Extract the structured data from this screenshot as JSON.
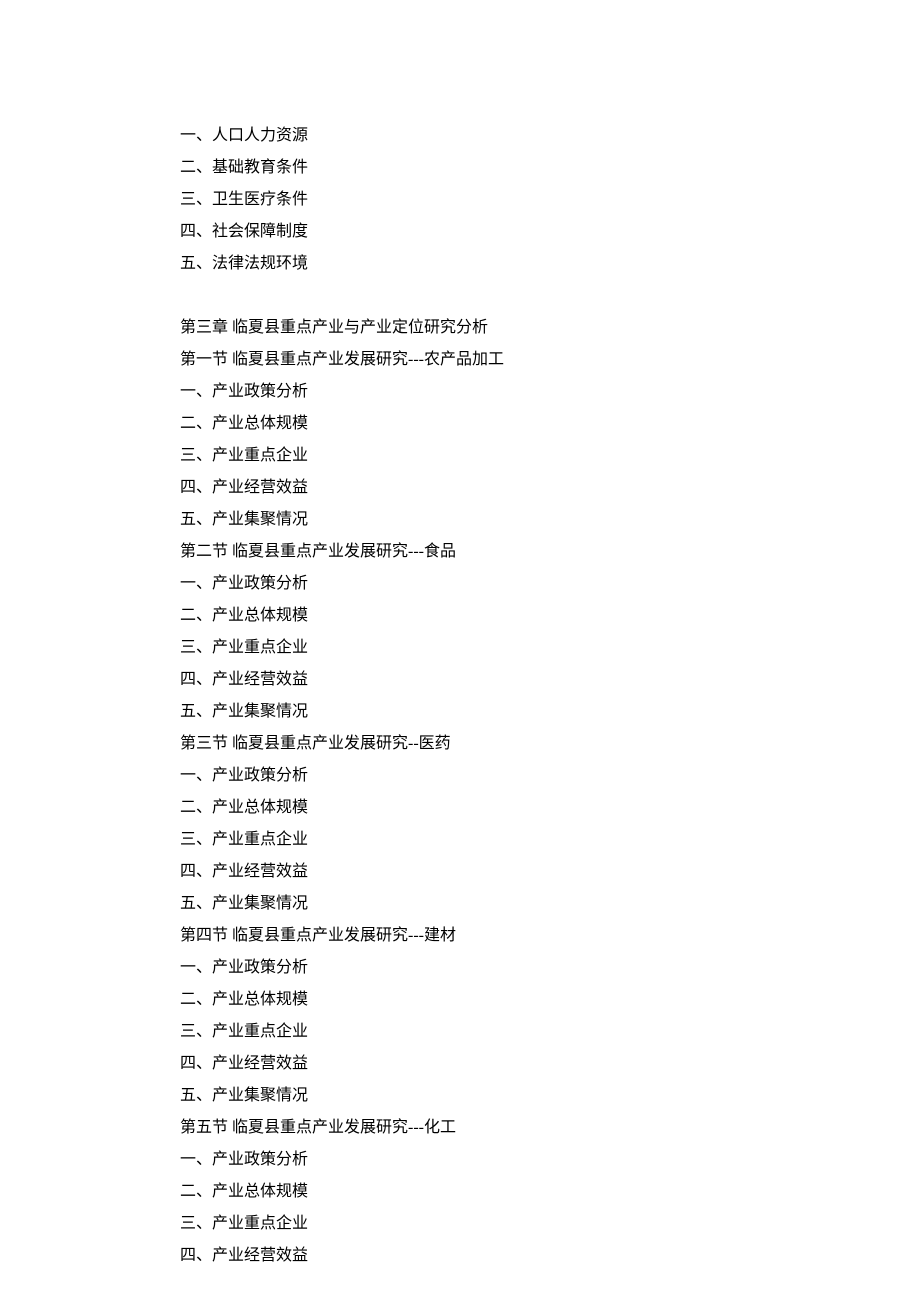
{
  "lines": [
    "一、人口人力资源",
    "二、基础教育条件",
    "三、卫生医疗条件",
    "四、社会保障制度",
    "五、法律法规环境",
    "__SPACER__",
    "第三章 临夏县重点产业与产业定位研究分析",
    "第一节 临夏县重点产业发展研究---农产品加工",
    "一、产业政策分析",
    "二、产业总体规模",
    "三、产业重点企业",
    "四、产业经营效益",
    "五、产业集聚情况",
    "第二节 临夏县重点产业发展研究---食品",
    "一、产业政策分析",
    "二、产业总体规模",
    "三、产业重点企业",
    "四、产业经营效益",
    "五、产业集聚情况",
    "第三节 临夏县重点产业发展研究--医药",
    "一、产业政策分析",
    "二、产业总体规模",
    "三、产业重点企业",
    "四、产业经营效益",
    "五、产业集聚情况",
    "第四节 临夏县重点产业发展研究---建材",
    "一、产业政策分析",
    "二、产业总体规模",
    "三、产业重点企业",
    "四、产业经营效益",
    "五、产业集聚情况",
    "第五节 临夏县重点产业发展研究---化工",
    "一、产业政策分析",
    "二、产业总体规模",
    "三、产业重点企业",
    "四、产业经营效益"
  ]
}
